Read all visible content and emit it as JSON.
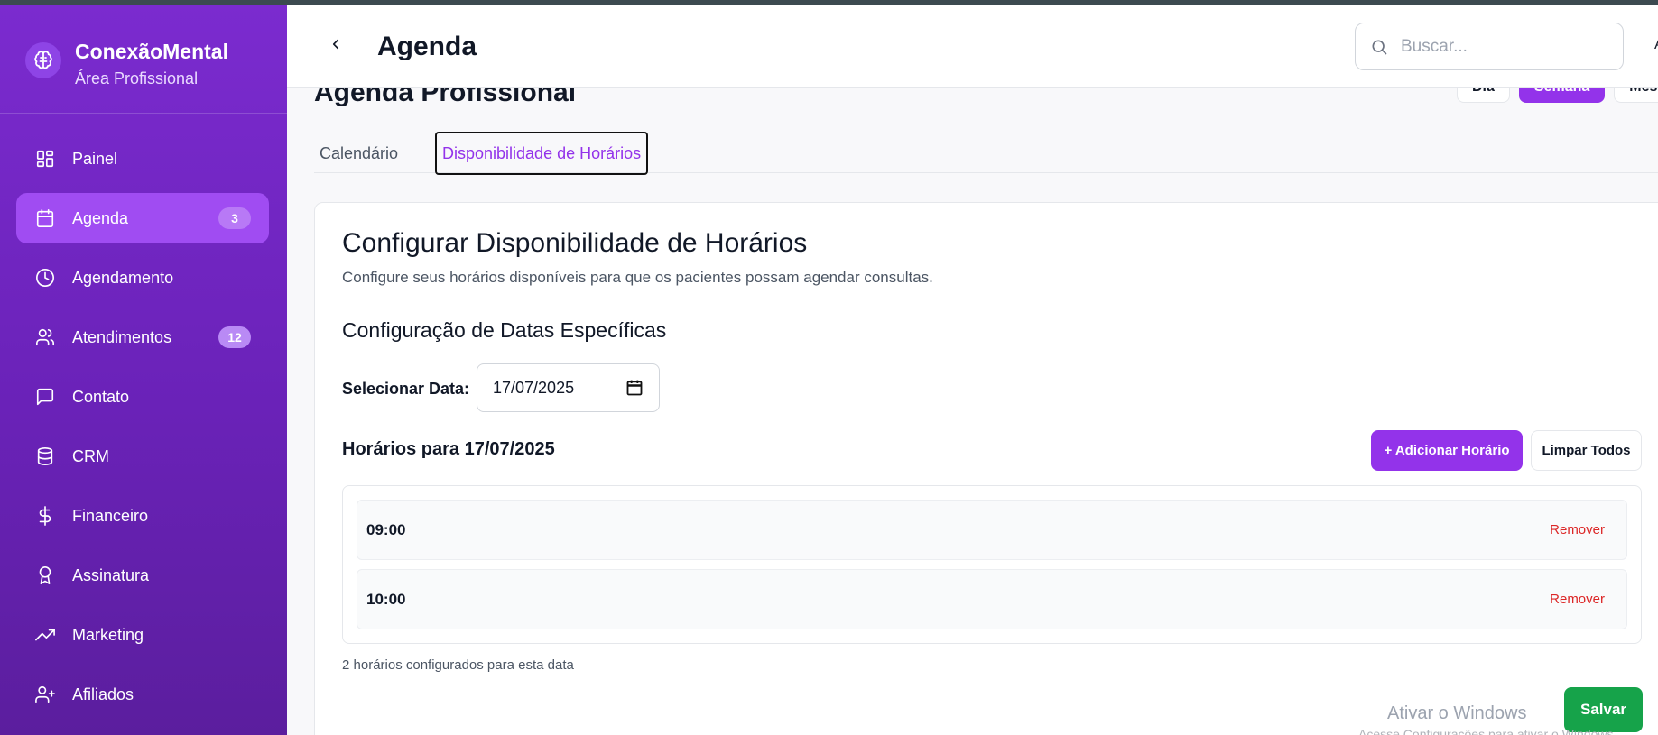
{
  "brand": {
    "name": "ConexãoMental",
    "subtitle": "Área Profissional"
  },
  "sidebar": {
    "items": [
      {
        "label": "Painel",
        "icon": "dashboard-icon"
      },
      {
        "label": "Agenda",
        "icon": "calendar-icon",
        "badge": "3",
        "active": true
      },
      {
        "label": "Agendamento",
        "icon": "clock-icon"
      },
      {
        "label": "Atendimentos",
        "icon": "users-icon",
        "badge": "12"
      },
      {
        "label": "Contato",
        "icon": "message-icon"
      },
      {
        "label": "CRM",
        "icon": "database-icon"
      },
      {
        "label": "Financeiro",
        "icon": "dollar-icon"
      },
      {
        "label": "Assinatura",
        "icon": "award-icon"
      },
      {
        "label": "Marketing",
        "icon": "trending-up-icon"
      },
      {
        "label": "Afiliados",
        "icon": "user-plus-icon"
      }
    ]
  },
  "header": {
    "title": "Agenda",
    "search_placeholder": "Buscar...",
    "edge_text": "A"
  },
  "main": {
    "section_heading": "Agenda Profissional",
    "view_buttons": [
      "Dia",
      "Semana",
      "Mês"
    ],
    "tabs": [
      {
        "label": "Calendário"
      },
      {
        "label": "Disponibilidade de Horários",
        "active": true
      }
    ],
    "card": {
      "title": "Configurar Disponibilidade de Horários",
      "description": "Configure seus horários disponíveis para que os pacientes possam agendar consultas.",
      "section_title": "Configuração de Datas Específicas",
      "date_label": "Selecionar Data:",
      "date_value": "17/07/2025",
      "hours_title": "Horários para 17/07/2025",
      "add_label": "+ Adicionar Horário",
      "clear_label": "Limpar Todos",
      "slots": [
        {
          "time": "09:00",
          "remove": "Remover"
        },
        {
          "time": "10:00",
          "remove": "Remover"
        }
      ],
      "count_text": "2 horários configurados para esta data",
      "save_label": "Salvar"
    }
  },
  "watermark": {
    "title": "Ativar o Windows",
    "subtitle": "Acesse Configurações para ativar o Windows."
  },
  "colors": {
    "sidebar": "#7b2bcf",
    "accent": "#9333ea",
    "active_nav": "#a04cf2",
    "save": "#16a34a",
    "danger": "#dc2626"
  }
}
